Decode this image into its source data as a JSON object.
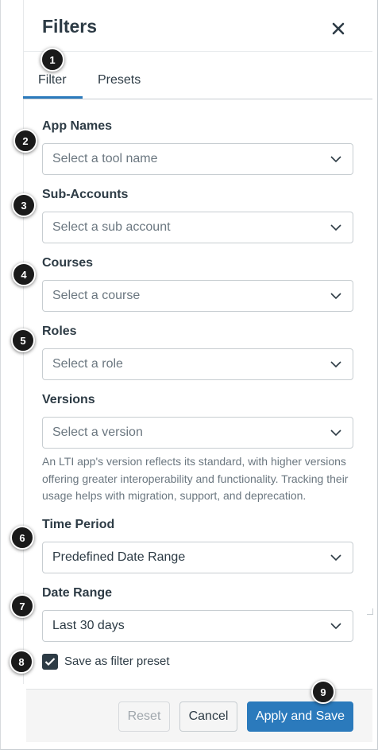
{
  "header": {
    "title": "Filters"
  },
  "tabs": [
    {
      "label": "Filter"
    },
    {
      "label": "Presets"
    }
  ],
  "fields": {
    "app_names": {
      "label": "App Names",
      "placeholder": "Select a tool name"
    },
    "sub_accounts": {
      "label": "Sub-Accounts",
      "placeholder": "Select a sub account"
    },
    "courses": {
      "label": "Courses",
      "placeholder": "Select a course"
    },
    "roles": {
      "label": "Roles",
      "placeholder": "Select a role"
    },
    "versions": {
      "label": "Versions",
      "placeholder": "Select a version",
      "help": "An LTI app's version reflects its standard, with higher versions offering greater interoperability and functionality. Tracking their usage helps with migration, support, and deprecation."
    },
    "time_period": {
      "label": "Time Period",
      "value": "Predefined Date Range"
    },
    "date_range": {
      "label": "Date Range",
      "value": "Last 30 days"
    }
  },
  "preset_checkbox": {
    "label": "Save as filter preset",
    "checked": true
  },
  "footer": {
    "reset": "Reset",
    "cancel": "Cancel",
    "apply": "Apply and Save"
  },
  "badges": [
    "1",
    "2",
    "3",
    "4",
    "5",
    "6",
    "7",
    "8",
    "9"
  ],
  "colors": {
    "accent": "#2b7abc",
    "text": "#2d3b45",
    "placeholder": "#6b7780",
    "badge": "#1a1a1a"
  }
}
